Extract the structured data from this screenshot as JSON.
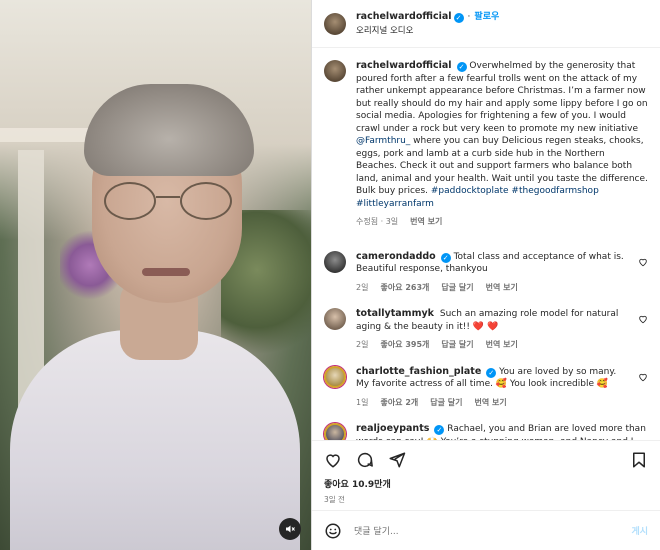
{
  "post": {
    "username": "rachelwardofficial",
    "follow_label": "팔로우",
    "audio_label": "오리지널 오디오",
    "caption_text": "Overwhelmed by the generosity that poured forth after a few fearful trolls went on the attack of my rather unkempt appearance before Christmas. I’m a farmer now but really should do my hair and apply some lippy before I go on social media. Apologies for frightening a few of you. I would crawl under a rock but very keen to promote my new initiative ",
    "caption_mention": "@Farmthru_",
    "caption_text2": " where you can buy Delicious regen steaks, chooks, eggs, pork and lamb at a curb side hub in the Northern Beaches. Check it out and support farmers who balance both land, animal and your health. Wait until you taste the difference. Bulk buy prices. ",
    "caption_hashtags": "#paddocktoplate #thegoodfarmshop #littleyarranfarm",
    "caption_meta_edited": "수정됨 · 3일",
    "caption_meta_translate": "번역 보기"
  },
  "comments": [
    {
      "username": "camerondaddo",
      "verified": true,
      "text": "Total class and acceptance of what is. Beautiful response, thankyou",
      "age": "2일",
      "likes": "좋아요 263개",
      "reply": "답글 달기",
      "translate": "번역 보기"
    },
    {
      "username": "totallytammyk",
      "verified": false,
      "text": "Such an amazing role model for natural aging & the beauty in it!!",
      "emoji": "❤️ ❤️",
      "age": "2일",
      "likes": "좋아요 395개",
      "reply": "답글 달기",
      "translate": "번역 보기"
    },
    {
      "username": "charlotte_fashion_plate",
      "verified": true,
      "text": "You are loved by so many. My favorite actress of all time. 🥰  You look incredible 🥰",
      "age": "1일",
      "likes": "좋아요 2개",
      "reply": "답글 달기",
      "translate": "번역 보기"
    },
    {
      "username": "realjoeypants",
      "verified": true,
      "text": "Rachael, you and Brian are loved more than words can say! 🙌  You’re a stunning woman, and Nancy and I"
    }
  ],
  "footer": {
    "likes": "좋아요 10.9만개",
    "age": "3일 전",
    "comment_placeholder": "댓글 달기...",
    "post_label": "게시"
  },
  "icons": {
    "heart": "heart-icon",
    "comment": "comment-icon",
    "share": "share-icon",
    "save": "bookmark-icon",
    "emoji": "emoji-icon",
    "mute": "mute-icon",
    "more": "more-icon"
  }
}
